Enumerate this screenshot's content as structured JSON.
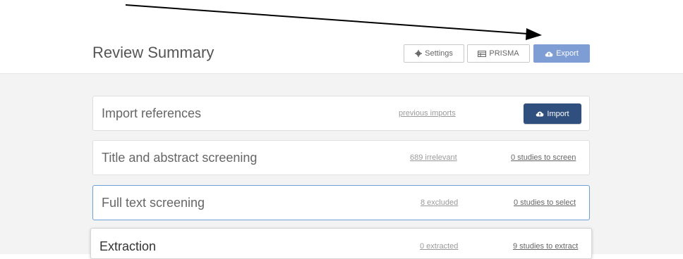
{
  "header": {
    "title": "Review Summary",
    "buttons": {
      "settings": "Settings",
      "prisma": "PRISMA",
      "export": "Export"
    }
  },
  "stages": [
    {
      "title": "Import references",
      "link": "previous imports",
      "action": "Import"
    },
    {
      "title": "Title and abstract screening",
      "secondary": "689 irrelevant",
      "primary": "0 studies to screen"
    },
    {
      "title": "Full text screening",
      "secondary": "8 excluded",
      "primary": "0 studies to select"
    },
    {
      "title": "Extraction",
      "secondary": "0 extracted",
      "primary": "9 studies to extract"
    }
  ],
  "icons": {
    "settings": "gear-icon",
    "prisma": "table-icon",
    "export": "cloud-upload-icon",
    "import": "cloud-upload-icon"
  },
  "colors": {
    "export_button": "#7f9dd5",
    "import_button": "#2f4f7f",
    "active_card_border": "#6ca0d6",
    "content_background": "#f3f3f3"
  }
}
